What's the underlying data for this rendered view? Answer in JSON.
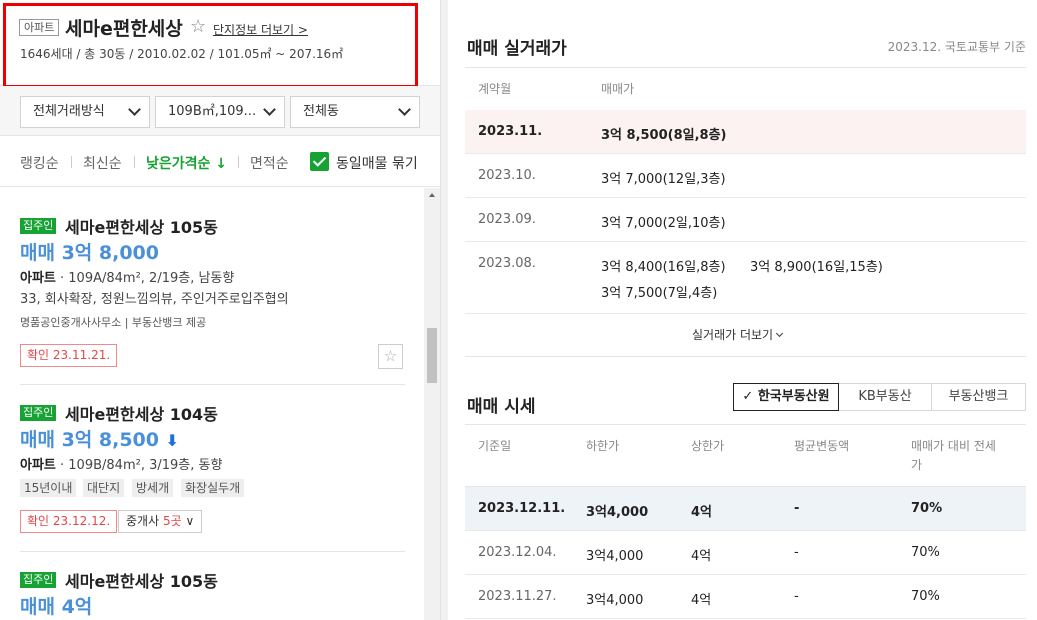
{
  "complex": {
    "type": "아파트",
    "name": "세마e편한세상",
    "star": "☆",
    "more_info": "단지정보 더보기 >",
    "meta": "1646세대 / 총 30동 / 2010.02.02 / 101.05㎡ ~ 207.16㎡"
  },
  "filters": {
    "trade_type": "전체거래방식",
    "area": "109B㎡,109...",
    "dong": "전체동"
  },
  "sort": {
    "ranking": "랭킹순",
    "latest": "최신순",
    "low_price": "낮은가격순 ↓",
    "area": "면적순",
    "group_label": "동일매물 묶기"
  },
  "listings": [
    {
      "badge": "집주인",
      "title": "세마e편한세상 105동",
      "price": "매매 3억 8,000",
      "spec_type": "아파트",
      "spec": " · 109A/84m², 2/19층, 남동향",
      "desc": "33, 회사확장, 정원느낌의뷰, 주인거주로입주협의",
      "source": "명품공인중개사사무소 | 부동산뱅크 제공",
      "confirm": "확인 23.11.21."
    },
    {
      "badge": "집주인",
      "title": "세마e편한세상 104동",
      "price": "매매 3억 8,500",
      "spec_type": "아파트",
      "spec": " · 109B/84m², 3/19층, 동향",
      "tags": [
        "15년이내",
        "대단지",
        "방세개",
        "화장실두개"
      ],
      "confirm": "확인 23.12.12.",
      "agents_label": "중개사 ",
      "agents_count": "5곳"
    },
    {
      "badge": "집주인",
      "title": "세마e편한세상 105동",
      "price": "매매 4억"
    }
  ],
  "trades": {
    "title": "매매 실거래가",
    "basis": "2023.12. 국토교통부 기준",
    "headers": {
      "month": "계약월",
      "price": "매매가"
    },
    "rows": [
      {
        "month": "2023.11.",
        "price1": "3억 8,500(8일,8층)"
      },
      {
        "month": "2023.10.",
        "price1": "3억 7,000(12일,3층)"
      },
      {
        "month": "2023.09.",
        "price1": "3억 7,000(2일,10층)"
      },
      {
        "month": "2023.08.",
        "price1": "3억 8,400(16일,8층)",
        "price2": "3억 8,900(16일,15층)",
        "price3": "3억 7,500(7일,4층)"
      }
    ],
    "more": "실거래가 더보기"
  },
  "market": {
    "title": "매매 시세",
    "tabs": [
      "✓ 한국부동산원",
      "KB부동산",
      "부동산뱅크"
    ],
    "headers": {
      "date": "기준일",
      "low": "하한가",
      "high": "상한가",
      "avg": "평균변동액",
      "ratio_1": "매매가 대비 전세",
      "ratio_2": "가"
    },
    "rows": [
      {
        "date": "2023.12.11.",
        "low": "3억4,000",
        "high": "4억",
        "avg": "-",
        "ratio": "70%"
      },
      {
        "date": "2023.12.04.",
        "low": "3억4,000",
        "high": "4억",
        "avg": "-",
        "ratio": "70%"
      },
      {
        "date": "2023.11.27.",
        "low": "3억4,000",
        "high": "4억",
        "avg": "-",
        "ratio": "70%"
      }
    ]
  }
}
